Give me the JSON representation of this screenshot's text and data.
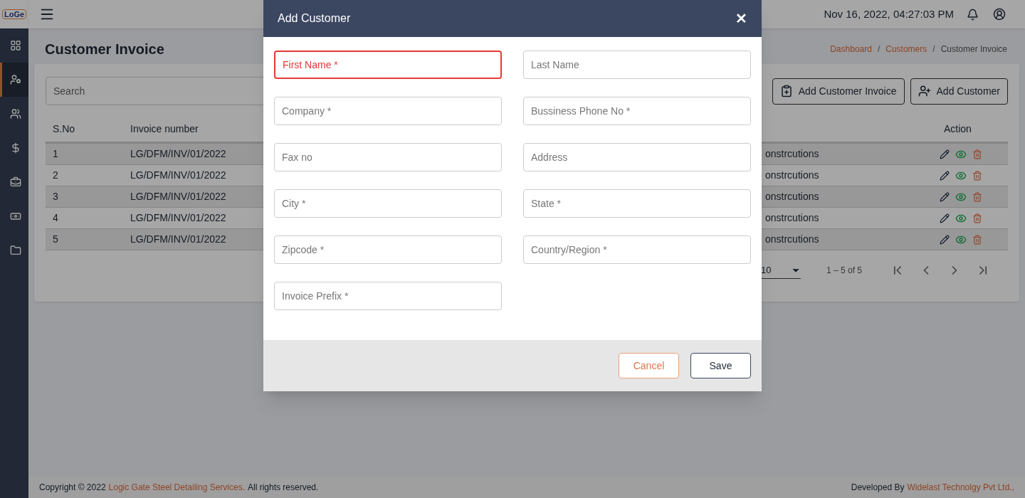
{
  "logo": "LoGe",
  "sidebar": {
    "items": [
      {
        "kind": "dashboard",
        "selected": false
      },
      {
        "kind": "user-settings",
        "selected": true
      },
      {
        "kind": "users",
        "selected": false
      },
      {
        "kind": "dollar",
        "selected": false
      },
      {
        "kind": "badge",
        "selected": false
      },
      {
        "kind": "cash",
        "selected": false
      },
      {
        "kind": "folder",
        "selected": false
      }
    ]
  },
  "topbar": {
    "datetime": "Nov 16, 2022, 04:27:03 PM"
  },
  "page": {
    "title": "Customer Invoice",
    "breadcrumb": [
      {
        "label": "Dashboard",
        "link": true
      },
      {
        "label": "Customers",
        "link": true
      },
      {
        "label": "Customer Invoice",
        "link": false
      }
    ],
    "separator": "/"
  },
  "search": {
    "placeholder": "Search"
  },
  "actions": [
    {
      "kind": "invoice",
      "label": "Add Customer Invoice"
    },
    {
      "kind": "customer",
      "label": "Add Customer"
    }
  ],
  "table": {
    "columns": [
      "S.No",
      "Invoice number",
      "",
      "Action"
    ],
    "rows": [
      [
        "1",
        "LG/DFM/INV/01/2022",
        "onstrcutions"
      ],
      [
        "2",
        "LG/DFM/INV/01/2022",
        "onstrcutions"
      ],
      [
        "3",
        "LG/DFM/INV/01/2022",
        "onstrcutions"
      ],
      [
        "4",
        "LG/DFM/INV/01/2022",
        "onstrcutions"
      ],
      [
        "5",
        "LG/DFM/INV/01/2022",
        "onstrcutions"
      ]
    ]
  },
  "pagination": {
    "page_size": "10",
    "range": "1 – 5 of 5"
  },
  "footer": {
    "left_prefix": "Copyright © 2022",
    "left_link": "Logic Gate Steel Detailing Services.",
    "left_suffix": "All rights reserved.",
    "right_prefix": "Developed By",
    "right_link": "Widelast Technolgy Pvt Ltd.,"
  },
  "dialog": {
    "title": "Add Customer",
    "close": "✕",
    "fields": [
      {
        "placeholder": "First Name *",
        "error": true
      },
      {
        "placeholder": "Last Name",
        "error": false
      },
      {
        "placeholder": "Company *",
        "error": false
      },
      {
        "placeholder": "Bussiness Phone No *",
        "error": false
      },
      {
        "placeholder": "Fax no",
        "error": false
      },
      {
        "placeholder": "Address",
        "error": false
      },
      {
        "placeholder": "City *",
        "error": false
      },
      {
        "placeholder": "State *",
        "error": false
      },
      {
        "placeholder": "Zipcode *",
        "error": false
      },
      {
        "placeholder": "Country/Region *",
        "error": false
      },
      {
        "placeholder": "Invoice Prefix *",
        "error": false
      }
    ],
    "buttons": [
      {
        "kind": "cancel",
        "label": "Cancel"
      },
      {
        "kind": "save",
        "label": "Save"
      }
    ]
  }
}
